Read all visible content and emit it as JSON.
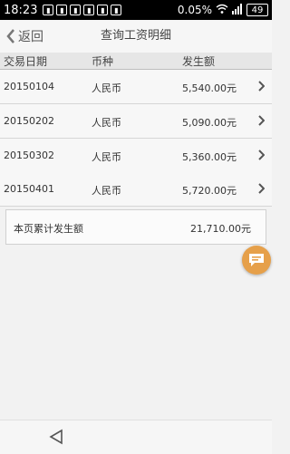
{
  "status": {
    "time": "18:23",
    "battery_text": "0.05%",
    "battery_level": "49"
  },
  "nav": {
    "back_label": "返回",
    "title": "查询工资明细"
  },
  "table": {
    "headers": [
      "交易日期",
      "币种",
      "发生额"
    ],
    "rows": [
      {
        "date": "20150104",
        "currency": "人民币",
        "amount": "5,540.00元"
      },
      {
        "date": "20150202",
        "currency": "人民币",
        "amount": "5,090.00元"
      },
      {
        "date": "20150302",
        "currency": "人民币",
        "amount": "5,360.00元"
      },
      {
        "date": "20150401",
        "currency": "人民币",
        "amount": "5,720.00元"
      }
    ]
  },
  "summary": {
    "label": "本页累计发生额",
    "value": "21,710.00元"
  },
  "colors": {
    "accent": "#e6a04a"
  },
  "icons": {
    "back": "chevron-left-icon",
    "row": "chevron-right-icon",
    "fab": "chat-icon",
    "system_back": "triangle-left-icon"
  }
}
